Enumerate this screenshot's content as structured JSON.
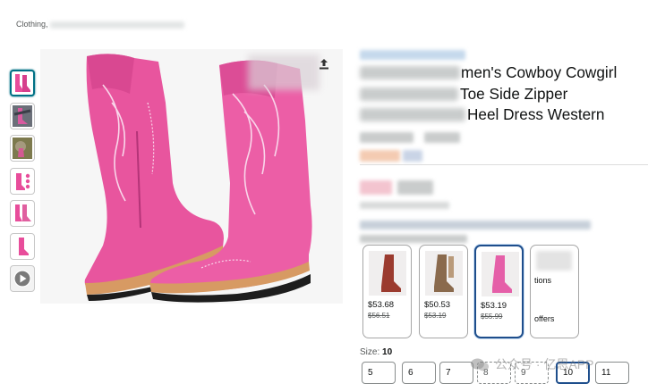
{
  "breadcrumb": {
    "first_crumb": "Clothing, "
  },
  "thumbnails": [
    {
      "name": "thumb-pink-pair",
      "active": true
    },
    {
      "name": "thumb-worn-photo",
      "active": false
    },
    {
      "name": "thumb-lifestyle-photo",
      "active": false
    },
    {
      "name": "thumb-features",
      "active": false
    },
    {
      "name": "thumb-side-view",
      "active": false
    },
    {
      "name": "thumb-single-boot",
      "active": false
    },
    {
      "name": "thumb-video",
      "active": false,
      "icon": "play-icon"
    }
  ],
  "product": {
    "title_line1_visible": "men's Cowboy Cowgirl",
    "title_line2_visible": "Toe Side Zipper",
    "title_line3_visible": "Heel Dress Western",
    "accent_color": "#e84d9b"
  },
  "colors": {
    "swatches": [
      {
        "price": "$53.68",
        "was": "$56.51",
        "boot_color": "#9b3b2f"
      },
      {
        "price": "$50.53",
        "was": "$53.19",
        "boot_color": "#8a6a4d"
      },
      {
        "price": "$53.19",
        "was": "$55.99",
        "boot_color": "#e55fa8",
        "selected": true
      },
      {
        "options_text": "tions",
        "offers_text": "offers"
      }
    ]
  },
  "size": {
    "label": "Size:",
    "selected": "10",
    "options": [
      {
        "label": "5",
        "state": "available"
      },
      {
        "label": "6",
        "state": "available"
      },
      {
        "label": "7",
        "state": "available"
      },
      {
        "label": "8",
        "state": "unavailable"
      },
      {
        "label": "9",
        "state": "unavailable"
      },
      {
        "label": "10",
        "state": "selected"
      },
      {
        "label": "11",
        "state": "available"
      }
    ]
  },
  "watermark": {
    "text": "公众号 · 亿恩APP"
  }
}
